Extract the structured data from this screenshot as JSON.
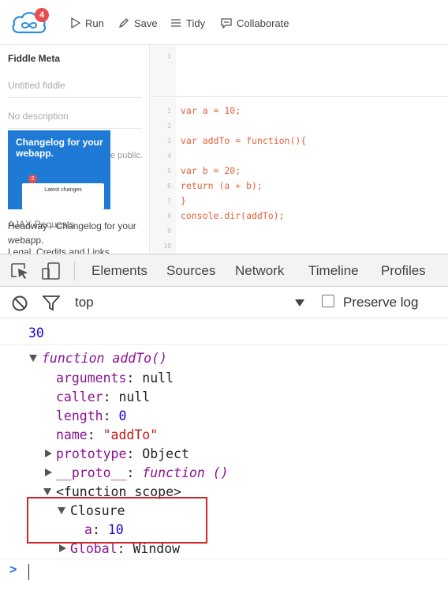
{
  "toolbar": {
    "badge_count": "4",
    "run": "Run",
    "save": "Save",
    "tidy": "Tidy",
    "collaborate": "Collaborate"
  },
  "sidebar": {
    "title": "Fiddle Meta",
    "name_placeholder": "Untitled fiddle",
    "description_placeholder": "No description",
    "public_text": "e public.",
    "ad": {
      "title": "Changelog for your webapp.",
      "badge": "2",
      "panel_text": "Latest changes",
      "description": "Headway - Changelog for your webapp.",
      "overlap_text": "AJAX Requests"
    },
    "legal_link": "Legal, Credits and Links"
  },
  "editor": {
    "html_lines": [
      "1"
    ],
    "js_lines": [
      {
        "n": "1",
        "code": "var a = 10;"
      },
      {
        "n": "2",
        "code": ""
      },
      {
        "n": "3",
        "code": "var addTo = function(){"
      },
      {
        "n": "4",
        "code": ""
      },
      {
        "n": "5",
        "code": "var b = 20;"
      },
      {
        "n": "6",
        "code": "return (a + b);"
      },
      {
        "n": "7",
        "code": "}"
      },
      {
        "n": "8",
        "code": "console.dir(addTo);"
      },
      {
        "n": "9",
        "code": ""
      },
      {
        "n": "10",
        "code": ""
      }
    ]
  },
  "devtools": {
    "tabs": [
      "Elements",
      "Sources",
      "Network",
      "Timeline",
      "Profiles"
    ],
    "context": "top",
    "preserve_log": "Preserve log"
  },
  "console": {
    "result": "30",
    "fn_keyword": "function",
    "fn_name": "addTo()",
    "arguments_key": "arguments",
    "arguments_val": "null",
    "caller_key": "caller",
    "caller_val": "null",
    "length_key": "length",
    "length_val": "0",
    "name_key": "name",
    "name_val": "\"addTo\"",
    "prototype_key": "prototype",
    "prototype_val": "Object",
    "proto_key": "__proto__",
    "proto_val_fn": "function",
    "proto_val_parens": "()",
    "scope_label": "<function scope>",
    "closure_label": "Closure",
    "closure_var_key": "a",
    "closure_var_val": "10",
    "global_key": "Global",
    "global_val": "Window",
    "prompt": ">"
  },
  "colors": {
    "accent_red": "#d0282a",
    "console_number": "#1c00cf",
    "console_property": "#881391",
    "console_string": "#c41a16"
  }
}
